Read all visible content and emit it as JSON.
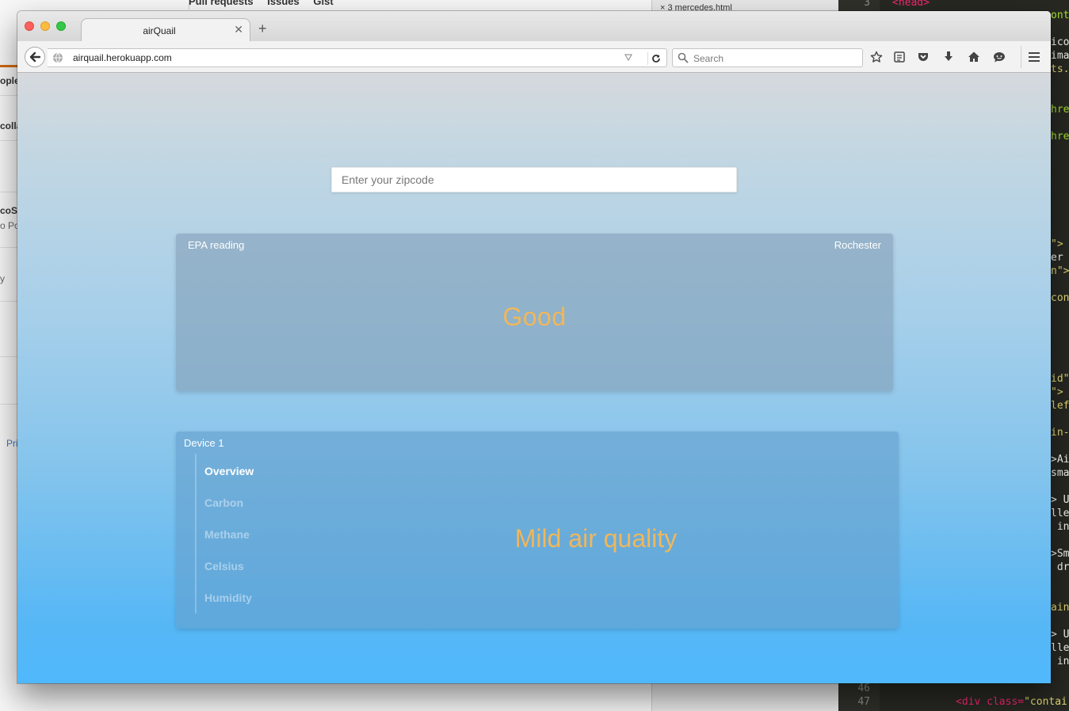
{
  "background": {
    "github_nav": [
      "Pull requests",
      "Issues",
      "Gist"
    ],
    "github_fragments": [
      "ople",
      "colla",
      "coST",
      "o Po",
      "y",
      "Pri"
    ],
    "tab_fragment": "× 3 mercedes.html",
    "editor_line_numbers": [
      "3",
      "46",
      "47"
    ],
    "editor_first_line": "<head>",
    "editor_last_line_tag": "<div class=",
    "editor_last_line_str": "\"contai",
    "editor_right_fragments": [
      {
        "text": "ont",
        "color": "#a6e22e"
      },
      {
        "text": "ico",
        "color": "#f8f8f2"
      },
      {
        "text": "ima",
        "color": "#f8f8f2"
      },
      {
        "text": "ts.",
        "color": "#e6db74"
      },
      {
        "text": "hre",
        "color": "#a6e22e"
      },
      {
        "text": "hre",
        "color": "#a6e22e"
      },
      {
        "text": "\">",
        "color": "#e6db74"
      },
      {
        "text": "er",
        "color": "#f8f8f2"
      },
      {
        "text": "n\">",
        "color": "#e6db74"
      },
      {
        "text": "con",
        "color": "#e6db74"
      },
      {
        "text": "id\"",
        "color": "#e6db74"
      },
      {
        "text": "\">",
        "color": "#e6db74"
      },
      {
        "text": "lef",
        "color": "#e6db74"
      },
      {
        "text": "in-",
        "color": "#e6db74"
      },
      {
        "text": ">Ai",
        "color": "#f8f8f2"
      },
      {
        "text": "sma",
        "color": "#f8f8f2"
      },
      {
        "text": "> U",
        "color": "#f8f8f2"
      },
      {
        "text": "lle",
        "color": "#f8f8f2"
      },
      {
        "text": " in",
        "color": "#f8f8f2"
      },
      {
        "text": ">Sm",
        "color": "#f8f8f2"
      },
      {
        "text": " dr",
        "color": "#f8f8f2"
      },
      {
        "text": "ain",
        "color": "#e6db74"
      },
      {
        "text": "> U",
        "color": "#f8f8f2"
      },
      {
        "text": "lle",
        "color": "#f8f8f2"
      },
      {
        "text": " in",
        "color": "#f8f8f2"
      }
    ]
  },
  "browser": {
    "tab_title": "airQuail",
    "url": "airquail.herokuapp.com",
    "search_placeholder": "Search",
    "toolbar_icons": [
      "bookmark-star-icon",
      "reading-list-icon",
      "pocket-icon",
      "downloads-icon",
      "home-icon",
      "chat-icon",
      "menu-icon"
    ]
  },
  "page": {
    "zip_placeholder": "Enter your zipcode",
    "epa": {
      "label": "EPA reading",
      "city": "Rochester",
      "status": "Good"
    },
    "device": {
      "label": "Device 1",
      "tabs": [
        "Overview",
        "Carbon",
        "Methane",
        "Celsius",
        "Humidity"
      ],
      "active_tab": "Overview",
      "status": "Mild air quality"
    },
    "colors": {
      "status_text": "#f0b75a",
      "gradient_top": "#d6d9dd",
      "gradient_bottom": "#4fb8fc"
    }
  }
}
